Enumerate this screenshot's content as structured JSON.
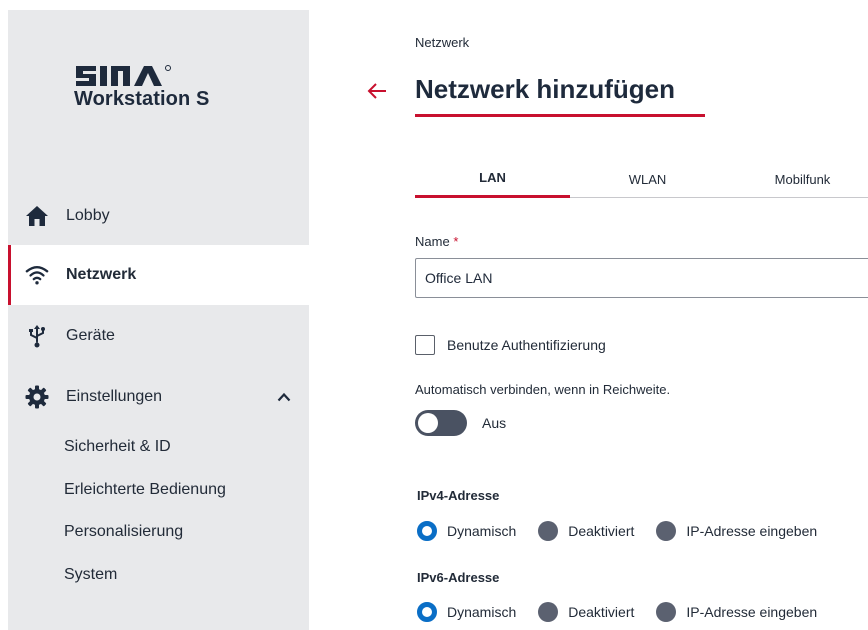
{
  "sidebar": {
    "logo": {
      "brand": "SINA",
      "product": "Workstation S"
    },
    "nav": [
      {
        "label": "Lobby",
        "icon": "home-icon"
      },
      {
        "label": "Netzwerk",
        "icon": "wifi-icon",
        "active": true
      },
      {
        "label": "Geräte",
        "icon": "usb-icon"
      },
      {
        "label": "Einstellungen",
        "icon": "gear-icon",
        "expanded": true
      }
    ],
    "settings_subitems": [
      "Sicherheit & ID",
      "Erleichterte Bedienung",
      "Personalisierung",
      "System"
    ]
  },
  "main": {
    "breadcrumb": "Netzwerk",
    "title": "Netzwerk hinzufügen",
    "tabs": [
      {
        "label": "LAN",
        "active": true
      },
      {
        "label": "WLAN"
      },
      {
        "label": "Mobilfunk"
      }
    ],
    "name_field": {
      "label": "Name",
      "required_mark": "*",
      "value": "Office LAN"
    },
    "auth_checkbox": {
      "label": "Benutze Authentifizierung",
      "checked": false
    },
    "auto_connect": {
      "label": "Automatisch verbinden, wenn in Reichweite.",
      "state_label": "Aus",
      "on": false
    },
    "ipv4": {
      "label": "IPv4-Adresse",
      "options": [
        "Dynamisch",
        "Deaktiviert",
        "IP-Adresse eingeben"
      ],
      "selected": "Dynamisch"
    },
    "ipv6": {
      "label": "IPv6-Adresse",
      "options": [
        "Dynamisch",
        "Deaktiviert",
        "IP-Adresse eingeben"
      ],
      "selected": "Dynamisch"
    }
  },
  "colors": {
    "accent": "#c8102e",
    "sidebar_bg": "#e8e9eb",
    "radio_selected": "#0a6ec6",
    "text_dark": "#1e2a3c"
  }
}
